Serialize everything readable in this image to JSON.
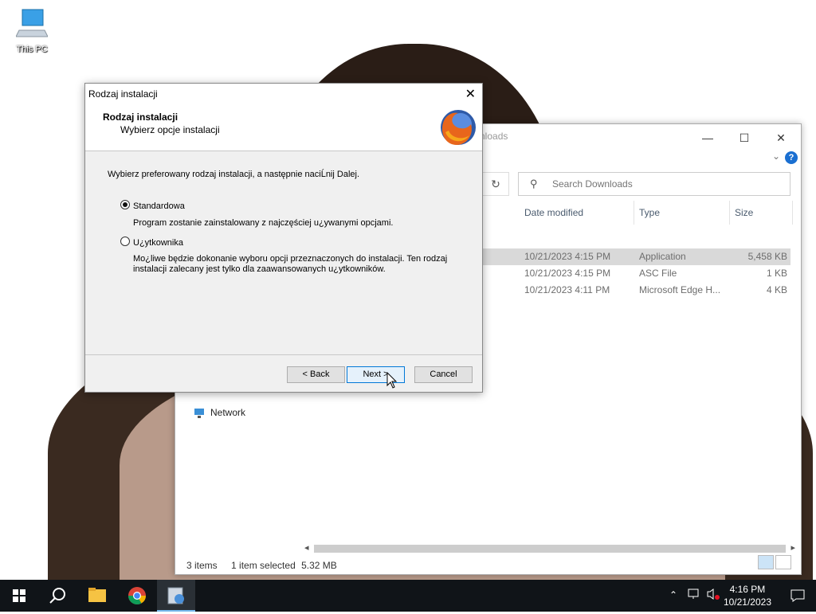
{
  "desktop": {
    "icon_label": "This PC"
  },
  "explorer": {
    "title_partial": "nloads",
    "search_placeholder": "Search Downloads",
    "columns": [
      "Date modified",
      "Type",
      "Size"
    ],
    "rows": [
      {
        "date": "10/21/2023 4:15 PM",
        "type": "Application",
        "size": "5,458 KB"
      },
      {
        "date": "10/21/2023 4:15 PM",
        "type": "ASC File",
        "size": "1 KB"
      },
      {
        "date": "10/21/2023 4:11 PM",
        "type": "Microsoft Edge H...",
        "size": "4 KB"
      }
    ],
    "nav_network": "Network",
    "status": {
      "items": "3 items",
      "selected": "1 item selected",
      "size": "5.32 MB"
    }
  },
  "dialog": {
    "title": "Rodzaj instalacji",
    "header_title": "Rodzaj instalacji",
    "header_subtitle": "Wybierz opcje instalacji",
    "intro": "Wybierz preferowany rodzaj instalacji, a następnie naciĹnij Dalej.",
    "option1_label": "Standardowa",
    "option1_desc": "Program zostanie zainstalowany z najczęściej u¿ywanymi opcjami.",
    "option2_label": "U¿ytkownika",
    "option2_desc": "Mo¿liwe będzie dokonanie wyboru opcji przeznaczonych do instalacji. Ten rodzaj instalacji zalecany jest tylko dla zaawansowanych u¿ytkowników.",
    "selected_option": "Standardowa",
    "btn_back": "< Back",
    "btn_next": "Next >",
    "btn_cancel": "Cancel"
  },
  "taskbar": {
    "time": "4:16 PM",
    "date": "10/21/2023"
  },
  "colors": {
    "taskbar": "#101418",
    "accent": "#0078d7",
    "selection": "#d9d9d9"
  }
}
